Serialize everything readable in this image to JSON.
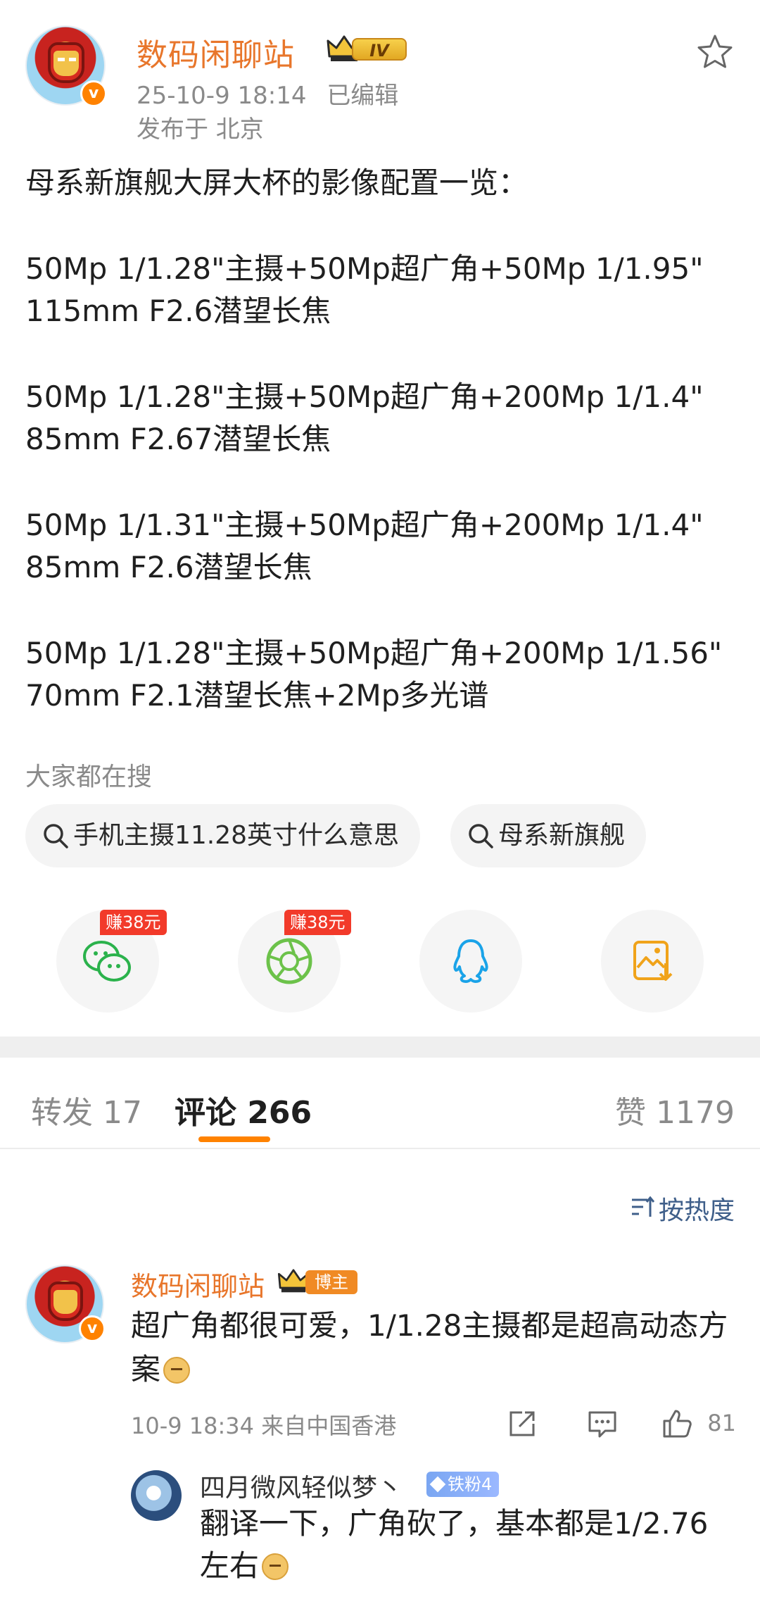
{
  "post": {
    "author": "数码闲聊站",
    "level_badge": "IV",
    "verified_badge": "v",
    "timestamp": "25-10-9 18:14",
    "edited": "已编辑",
    "location": "发布于 北京",
    "text": {
      "intro": "母系新旗舰大屏大杯的影像配置一览：",
      "config1": "50Mp 1/1.28\"主摄+50Mp超广角+50Mp 1/1.95\"\n115mm F2.6潜望长焦",
      "config2": "50Mp 1/1.28\"主摄+50Mp超广角+200Mp 1/1.4\"\n85mm F2.67潜望长焦",
      "config3": "50Mp 1/1.31\"主摄+50Mp超广角+200Mp 1/1.4\"\n85mm F2.6潜望长焦",
      "config4": "50Mp 1/1.28\"主摄+50Mp超广角+200Mp 1/1.56\"\n70mm F2.1潜望长焦+2Mp多光谱"
    }
  },
  "search": {
    "title": "大家都在搜",
    "chips": [
      "手机主摄11.28英寸什么意思",
      "母系新旗舰"
    ]
  },
  "share": {
    "earn_label": "赚38元",
    "icons": [
      "wechat-icon",
      "moments-icon",
      "qq-icon",
      "save-image-icon"
    ]
  },
  "tabs": {
    "repost": "转发 17",
    "comments": "评论 266",
    "likes": "赞 1179"
  },
  "sort_label": "按热度",
  "comment": {
    "author": "数码闲聊站",
    "badge": "博主",
    "text": "超广角都很可爱，1/1.28主摄都是超高动态方案",
    "meta": "10-9 18:34  来自中国香港",
    "like_count": "81"
  },
  "reply": {
    "author": "四月微风轻似梦丶",
    "badge": "铁粉4",
    "text": "翻译一下，广角砍了，基本都是1/2.76左右"
  },
  "colors": {
    "accent": "#ff8200",
    "username": "#e8762b",
    "earn_tag": "#f23a2a"
  }
}
